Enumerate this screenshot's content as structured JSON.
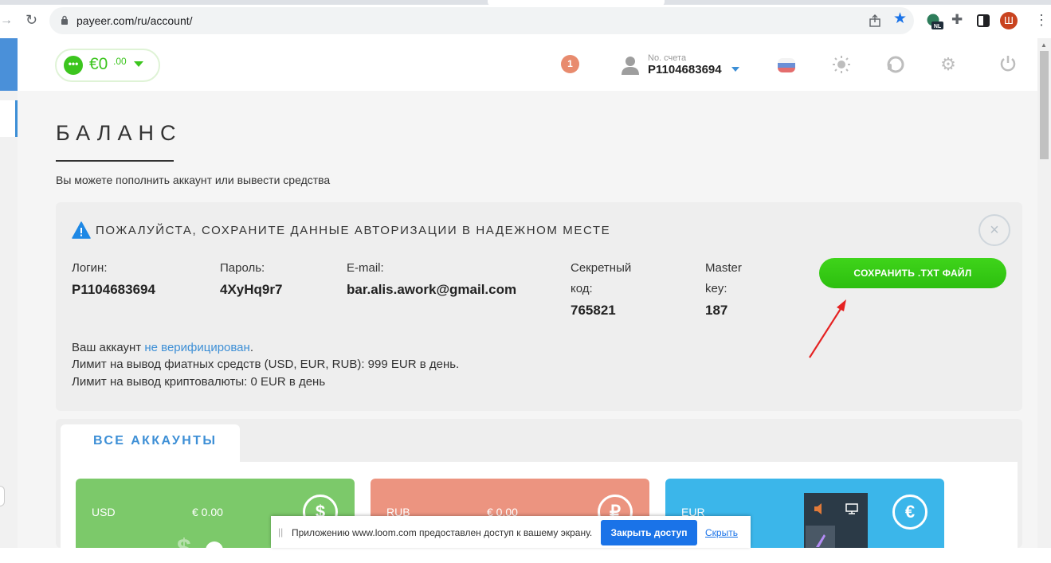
{
  "browser": {
    "url": "payeer.com/ru/account/",
    "profile_initial": "Ш",
    "ext_badge": "NL"
  },
  "header": {
    "wallet_currency": "€0",
    "wallet_cents": ".00",
    "notification_count": "1",
    "account_label": "No. счета",
    "account_number": "P1104683694"
  },
  "main": {
    "title": "БАЛАНС",
    "subtitle": "Вы можете пополнить аккаунт или вывести средства"
  },
  "alert": {
    "title": "ПОЖАЛУЙСТА, СОХРАНИТЕ ДАННЫЕ АВТОРИЗАЦИИ В НАДЕЖНОМ МЕСТЕ",
    "close_symbol": "×",
    "login_label": "Логин:",
    "login_value": "P1104683694",
    "password_label": "Пароль:",
    "password_value": "4XyHq9r7",
    "email_label": "E-mail:",
    "email_value": "bar.alis.awork@gmail.com",
    "secret_label_1": "Секретный",
    "secret_label_2": "код:",
    "secret_value": "765821",
    "master_label_1": "Master",
    "master_label_2": "key:",
    "master_value": "187",
    "save_button": "СОХРАНИТЬ .TXT ФАЙЛ",
    "account_status_prefix": "Ваш аккаунт ",
    "account_status_link": "не верифицирован",
    "account_status_suffix": ".",
    "fiat_limit": "Лимит на вывод фиатных средств (USD, EUR, RUB): 999 EUR в день.",
    "crypto_limit": "Лимит на вывод криптовалюты: 0 EUR в день"
  },
  "accounts": {
    "tab_label": "ВСЕ АККАУНТЫ",
    "cards": [
      {
        "currency": "USD",
        "amount": "€ 0.00",
        "symbol": "$",
        "color": "#7cc96a"
      },
      {
        "currency": "RUB",
        "amount": "€ 0.00",
        "symbol": "₽",
        "color": "#ec9480"
      },
      {
        "currency": "EUR",
        "amount": "",
        "symbol": "€",
        "color": "#3bb6ea"
      }
    ]
  },
  "loom": {
    "message": "Приложению www.loom.com предоставлен доступ к вашему экрану.",
    "stop_button": "Закрыть доступ",
    "hide_link": "Скрыть"
  },
  "colors": {
    "accent_green": "#3cc51e",
    "accent_blue": "#3d8fd6",
    "arrow_red": "#e52222"
  }
}
